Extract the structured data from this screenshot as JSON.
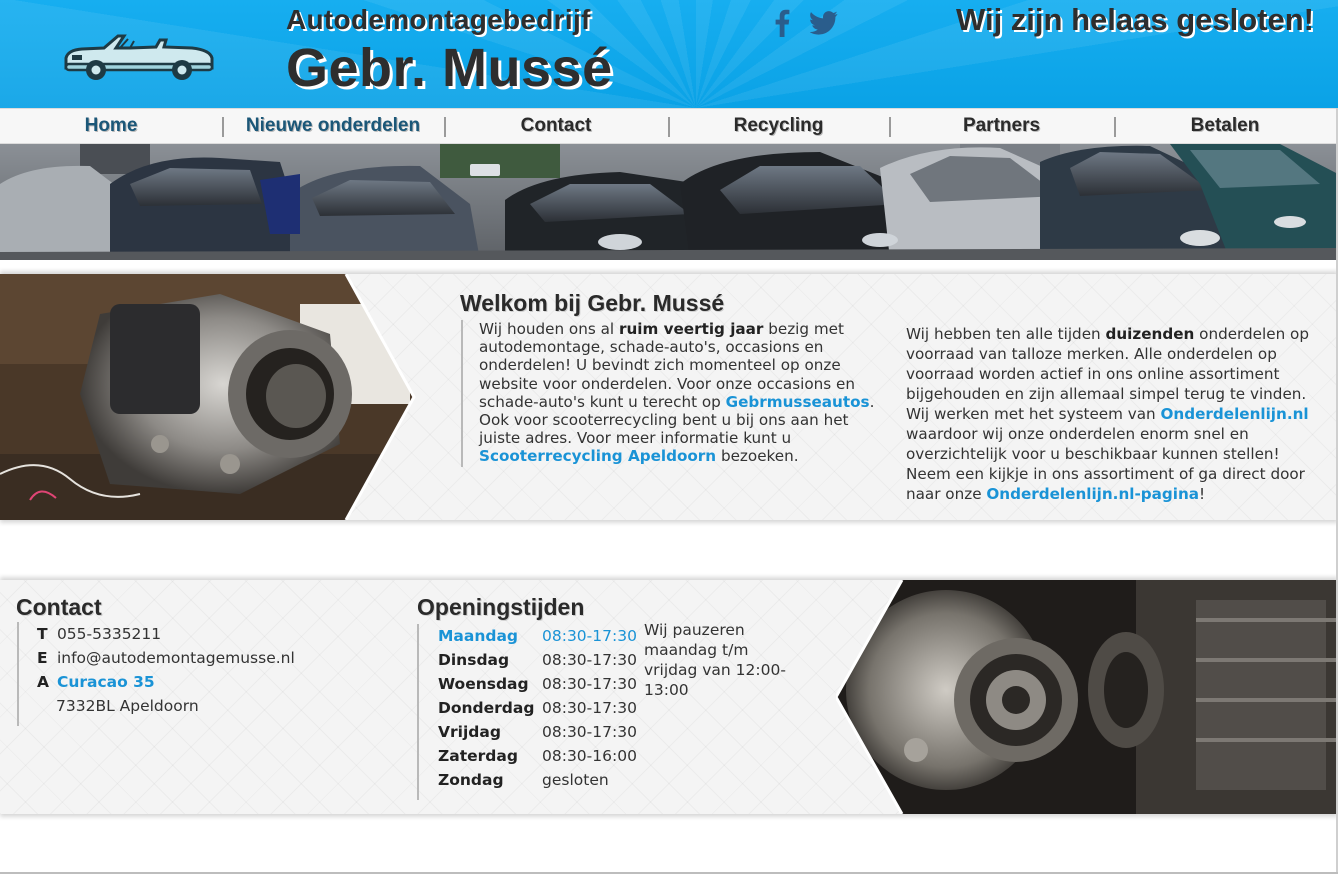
{
  "header": {
    "subtitle": "Autodemontagebedrijf",
    "title": "Gebr. Mussé",
    "closed_notice": "Wij zijn helaas gesloten!",
    "social": [
      {
        "name": "facebook-icon"
      },
      {
        "name": "twitter-icon"
      }
    ]
  },
  "nav": {
    "items": [
      {
        "label": "Home",
        "color": "#1b5778"
      },
      {
        "label": "Nieuwe onderdelen",
        "color": "#1b5778"
      },
      {
        "label": "Contact",
        "color": "#2b2b2b"
      },
      {
        "label": "Recycling",
        "color": "#2b2b2b"
      },
      {
        "label": "Partners",
        "color": "#2b2b2b"
      },
      {
        "label": "Betalen",
        "color": "#2b2b2b"
      }
    ]
  },
  "welcome": {
    "heading": "Welkom bij Gebr. Mussé",
    "col1": {
      "t1": "Wij houden ons al ",
      "b1": "ruim veertig jaar",
      "t2": " bezig met autodemontage, schade-auto's, occasions en onderdelen! U bevindt zich momenteel op onze website voor onderdelen. Voor onze occasions en schade-auto's kunt u terecht op ",
      "link1": "Gebrmusseautos",
      "t3": ". Ook voor scooterrecycling bent u bij ons aan het juiste adres. Voor meer informatie kunt u ",
      "link2": "Scooterrecycling Apeldoorn",
      "t4": " bezoeken."
    },
    "col2": {
      "t1": "Wij hebben ten alle tijden ",
      "b1": "duizenden",
      "t2": " onderdelen op voorraad van talloze merken. Alle onderdelen op voorraad worden actief in ons online assortiment bijgehouden en zijn allemaal simpel terug te vinden. Wij werken met het systeem van ",
      "link1": "Onderdelenlijn.nl",
      "t3": " waardoor wij onze onderdelen enorm snel en overzichtelijk voor u beschikbaar kunnen stellen! Neem een kijkje in ons assortiment of ga direct door naar onze ",
      "link2": "Onderdelenlijn.nl-pagina",
      "t4": "!"
    }
  },
  "contact": {
    "heading": "Contact",
    "phone_letter": "T",
    "phone": "055-5335211",
    "email_letter": "E",
    "email": "info@autodemontagemusse.nl",
    "address_letter": "A",
    "street": "Curacao 35",
    "city": "7332BL Apeldoorn"
  },
  "hours": {
    "heading": "Openingstijden",
    "rows": [
      {
        "day": "Maandag",
        "time": "08:30-17:30"
      },
      {
        "day": "Dinsdag",
        "time": "08:30-17:30"
      },
      {
        "day": "Woensdag",
        "time": "08:30-17:30"
      },
      {
        "day": "Donderdag",
        "time": "08:30-17:30"
      },
      {
        "day": "Vrijdag",
        "time": "08:30-17:30"
      },
      {
        "day": "Zaterdag",
        "time": "08:30-16:00"
      },
      {
        "day": "Zondag",
        "time": "gesloten"
      }
    ],
    "pause_note": "Wij pauzeren maandag t/m vrijdag van 12:00-13:00"
  },
  "colors": {
    "brand_blue": "#12a8ee",
    "link_blue": "#1a93d6",
    "heading_dark": "#2e2e2e"
  }
}
